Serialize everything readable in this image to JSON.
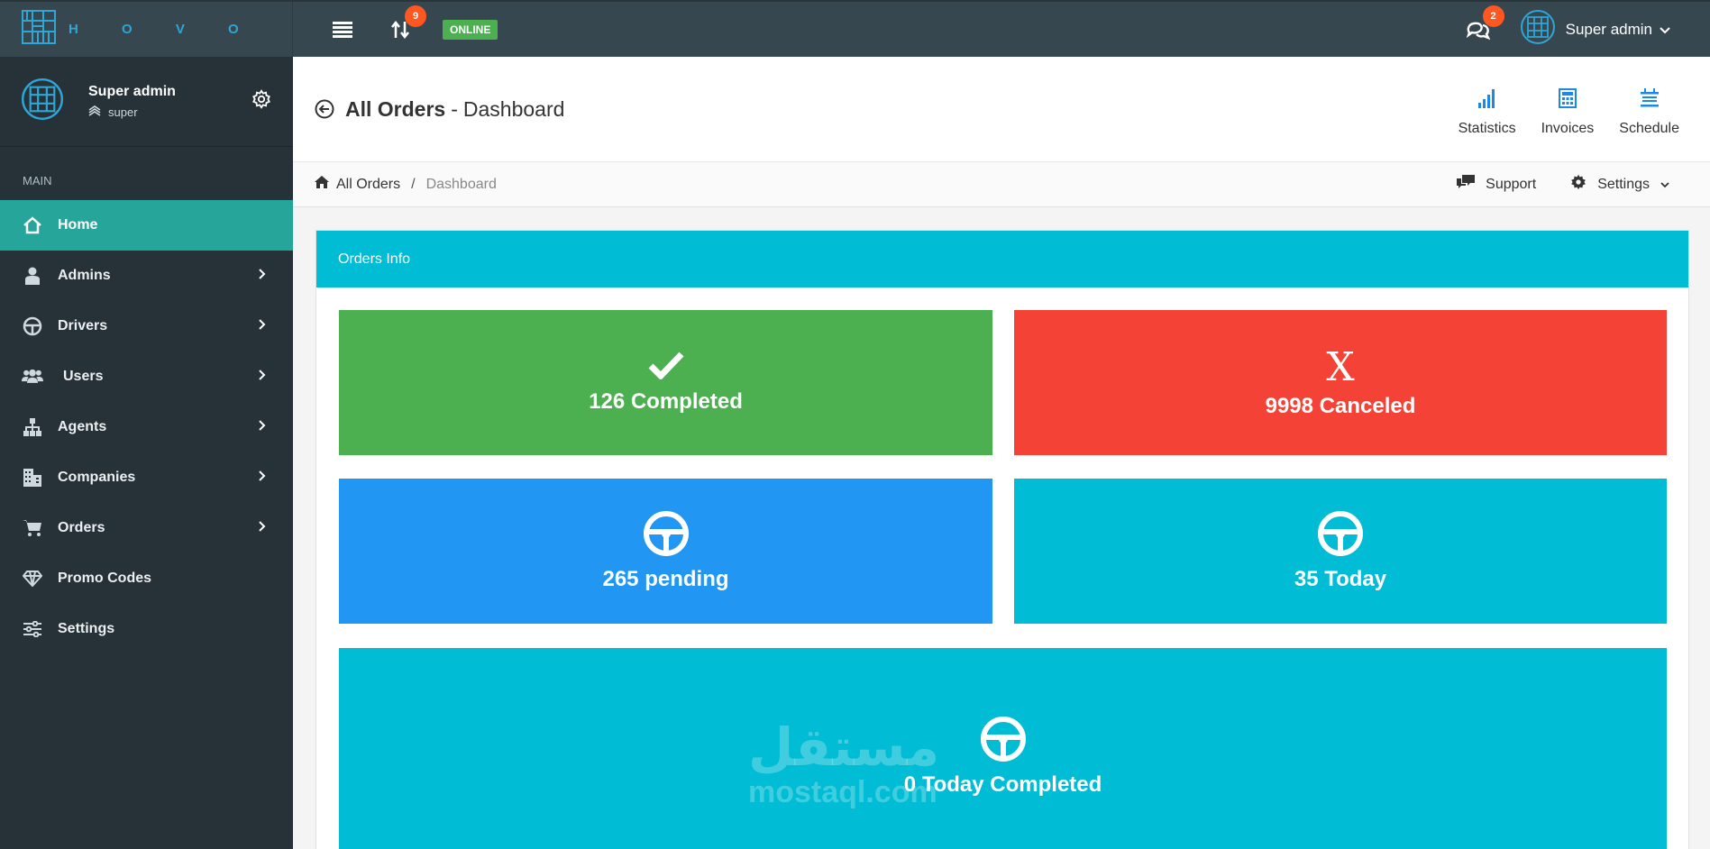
{
  "app": {
    "brand_text": "H O V O",
    "status": "ONLINE"
  },
  "topbar": {
    "notifications_count": "9",
    "messages_count": "2",
    "user_name": "Super admin"
  },
  "sidebar": {
    "profile": {
      "name": "Super admin",
      "role": "super"
    },
    "section_label": "MAIN",
    "items": [
      {
        "label": "Home",
        "icon": "home-icon",
        "active": true
      },
      {
        "label": "Admins",
        "icon": "admin-icon"
      },
      {
        "label": "Drivers",
        "icon": "steering-wheel-icon"
      },
      {
        "label": "Users",
        "icon": "users-icon"
      },
      {
        "label": "Agents",
        "icon": "hierarchy-icon"
      },
      {
        "label": "Companies",
        "icon": "building-icon"
      },
      {
        "label": "Orders",
        "icon": "cart-icon"
      },
      {
        "label": "Promo Codes",
        "icon": "diamond-icon"
      },
      {
        "label": "Settings",
        "icon": "sliders-icon"
      }
    ]
  },
  "header": {
    "title_strong": "All Orders",
    "title_sep": "-",
    "title_rest": "Dashboard",
    "actions": [
      {
        "label": "Statistics",
        "icon": "bar-chart-icon"
      },
      {
        "label": "Invoices",
        "icon": "calculator-icon"
      },
      {
        "label": "Schedule",
        "icon": "schedule-icon"
      }
    ]
  },
  "breadcrumb": {
    "home": "All Orders",
    "separator": "/",
    "current": "Dashboard",
    "support": "Support",
    "settings": "Settings"
  },
  "panel": {
    "title": "Orders Info",
    "stats": {
      "completed": "126 Completed",
      "canceled": "9998 Canceled",
      "canceled_glyph": "X",
      "pending": "265 pending",
      "today": "35 Today",
      "today_completed": "0 Today Completed"
    }
  },
  "watermark": {
    "arabic": "مستقل",
    "latin": "mostaql.com"
  },
  "colors": {
    "topbar": "#37474f",
    "sidebar": "#263238",
    "active": "#26a69a",
    "completed": "#4caf50",
    "canceled": "#f44336",
    "pending": "#2196f3",
    "today": "#00bcd4"
  }
}
